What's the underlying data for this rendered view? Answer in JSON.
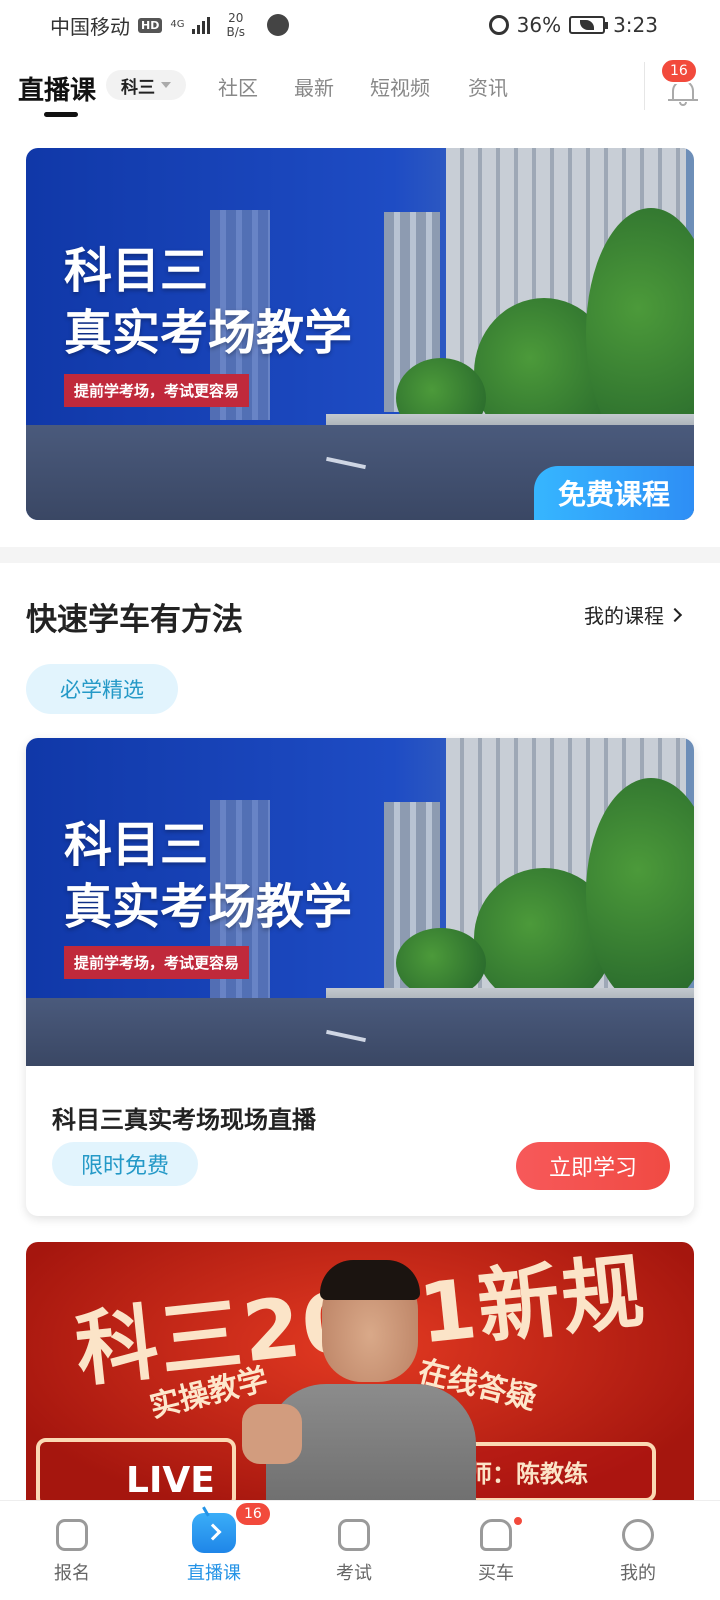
{
  "status_bar": {
    "carrier": "中国移动",
    "hd": "HD",
    "network": "4G",
    "speed_value": "20",
    "speed_unit": "B/s",
    "battery": "36%",
    "time": "3:23"
  },
  "top_nav": {
    "current": "直播课",
    "subject": "科三",
    "tabs": [
      "社区",
      "最新",
      "短视频",
      "资讯"
    ],
    "notification_count": "16"
  },
  "banner": {
    "title_line1": "科目三",
    "title_line2": "真实考场教学",
    "subtitle": "提前学考场，考试更容易",
    "tag": "免费课程"
  },
  "section": {
    "title": "快速学车有方法",
    "my_courses": "我的课程",
    "filter_pill": "必学精选"
  },
  "course_card": {
    "banner_title_line1": "科目三",
    "banner_title_line2": "真实考场教学",
    "banner_subtitle": "提前学考场，考试更容易",
    "title": "科目三真实考场现场直播",
    "tag": "限时免费",
    "button": "立即学习"
  },
  "promo": {
    "title": "科三2021新规",
    "sub_left": "实操教学",
    "sub_right": "在线答疑",
    "live": "LIVE",
    "teacher": "讲师：陈教练"
  },
  "tab_bar": {
    "tabs": [
      {
        "label": "报名",
        "icon": "register-icon"
      },
      {
        "label": "直播课",
        "icon": "live-tv-icon",
        "badge": "16"
      },
      {
        "label": "考试",
        "icon": "exam-icon"
      },
      {
        "label": "买车",
        "icon": "car-icon"
      },
      {
        "label": "我的",
        "icon": "profile-icon"
      }
    ]
  },
  "colors": {
    "accent_blue": "#2493e6",
    "badge_red": "#f24a3c",
    "pill_bg": "#e2f4fd",
    "pill_text": "#2499c7"
  }
}
